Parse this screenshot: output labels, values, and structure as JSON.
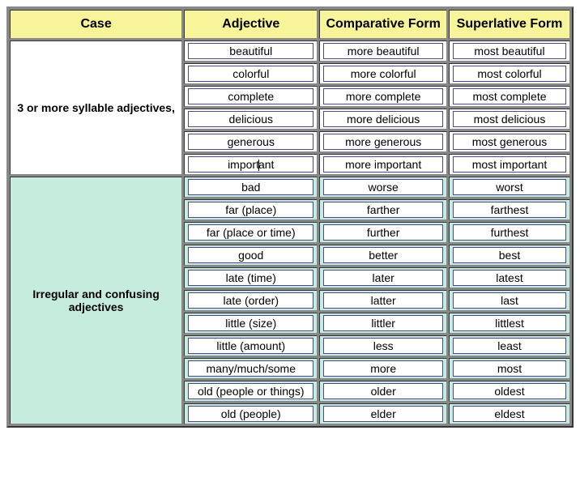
{
  "headers": {
    "case": "Case",
    "adjective": "Adjective",
    "comparative": "Comparative Form",
    "superlative": "Superlative Form"
  },
  "groups": [
    {
      "case_label": "3 or more syllable adjectives,",
      "mint": false,
      "rows": [
        {
          "adj": "beautiful",
          "comp": "more beautiful",
          "sup": "most beautiful"
        },
        {
          "adj": "colorful",
          "comp": "more colorful",
          "sup": "most colorful"
        },
        {
          "adj": "complete",
          "comp": "more complete",
          "sup": "most complete"
        },
        {
          "adj": "delicious",
          "comp": "more delicious",
          "sup": "most delicious"
        },
        {
          "adj": "generous",
          "comp": "more generous",
          "sup": "most generous"
        },
        {
          "adj": "important",
          "comp": "more important",
          "sup": "most important",
          "caret_after_adj_index": 6
        }
      ]
    },
    {
      "case_label": "Irregular and confusing adjectives",
      "mint": true,
      "rows": [
        {
          "adj": "bad",
          "comp": "worse",
          "sup": "worst"
        },
        {
          "adj": "far (place)",
          "comp": "farther",
          "sup": "farthest"
        },
        {
          "adj": "far (place or time)",
          "comp": "further",
          "sup": "furthest"
        },
        {
          "adj": "good",
          "comp": "better",
          "sup": "best"
        },
        {
          "adj": "late (time)",
          "comp": "later",
          "sup": "latest"
        },
        {
          "adj": "late (order)",
          "comp": "latter",
          "sup": "last"
        },
        {
          "adj": "little (size)",
          "comp": "littler",
          "sup": "littlest"
        },
        {
          "adj": "little (amount)",
          "comp": "less",
          "sup": "least"
        },
        {
          "adj": "many/much/some",
          "comp": "more",
          "sup": "most"
        },
        {
          "adj": "old (people or things)",
          "comp": "older",
          "sup": "oldest"
        },
        {
          "adj": "old (people)",
          "comp": "elder",
          "sup": "eldest"
        }
      ]
    }
  ]
}
